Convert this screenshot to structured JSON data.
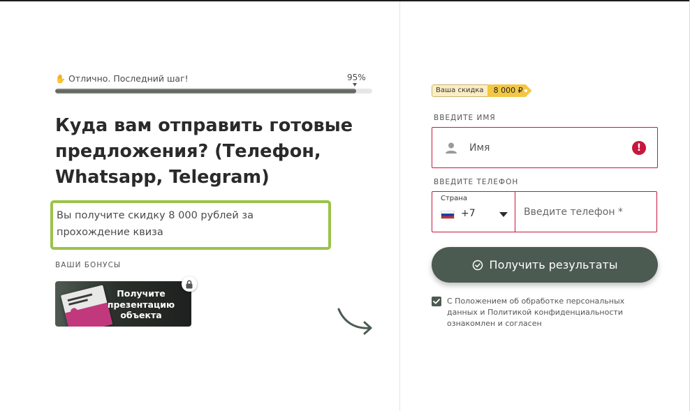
{
  "progress": {
    "label": "Отлично. Последний шаг!",
    "percent_text": "95%",
    "value": 95,
    "hand_icon": "waving-hand-icon"
  },
  "question": {
    "title": "Куда вам отправить готовые предложения? (Телефон, Whatsapp, Telegram)"
  },
  "discount_notice": {
    "text": "Вы получите скидку 8 000 рублей за прохождение квиза"
  },
  "bonuses": {
    "heading": "ВАШИ БОНУСЫ",
    "card_text": "Получите презентацию объекта",
    "lock_icon": "lock-icon"
  },
  "form": {
    "discount_tag": {
      "label": "Ваша скидка",
      "value": "8 000 ₽"
    },
    "name_label": "ВВЕДИТЕ ИМЯ",
    "name_placeholder": "Имя",
    "phone_label": "ВВЕДИТЕ ТЕЛЕФОН",
    "country_caption": "Страна",
    "country_code": "+7",
    "phone_placeholder": "Введите телефон *",
    "submit_label": "Получить результаты",
    "consent_text": "С Положением об обработке персональных данных и Политикой конфиденциальности ознакомлен и согласен",
    "consent_checked": true
  },
  "colors": {
    "accent": "#4c5b51",
    "error": "#c8163d",
    "highlight_border": "#9bc24a",
    "tag_yellow": "#f2c744"
  }
}
